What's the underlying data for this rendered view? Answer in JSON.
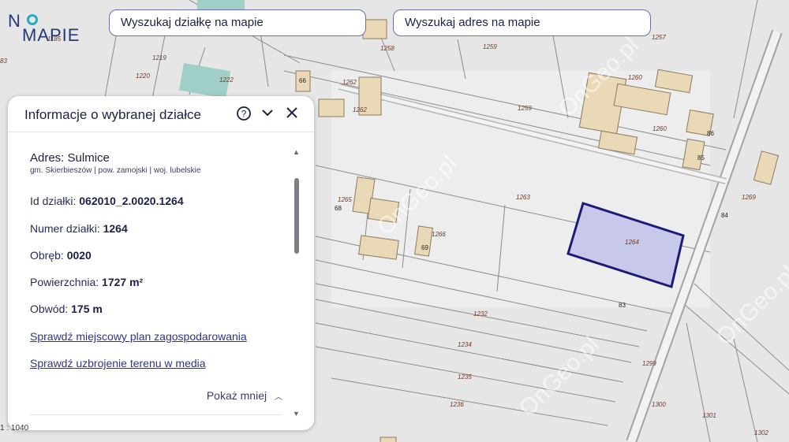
{
  "logo": {
    "line1": "N",
    "line2": "MAPIE"
  },
  "search": {
    "parcel_label": "Wyszukaj działkę na mapie",
    "address_label": "Wyszukaj adres na mapie"
  },
  "panel": {
    "title": "Informacje o wybranej działce",
    "help_icon": "help-circle-icon",
    "collapse_icon": "chevron-down-icon",
    "close_icon": "close-icon",
    "address_label": "Adres:",
    "address_value": "Sulmice",
    "admin_line": "gm. Skierbieszów | pow. zamojski | woj. lubelskie",
    "fields": [
      {
        "label": "Id działki:",
        "value": "062010_2.0020.1264"
      },
      {
        "label": "Numer działki:",
        "value": "1264"
      },
      {
        "label": "Obręb:",
        "value": "0020"
      },
      {
        "label": "Powierzchnia:",
        "value": "1727 m²"
      },
      {
        "label": "Obwód:",
        "value": "175 m"
      }
    ],
    "link_plan": "Sprawdź miejscowy plan zagospodarowania",
    "link_media": "Sprawdź uzbrojenie terenu w media",
    "show_less": "Pokaż mniej",
    "show_less_icon": "chevron-up-icon"
  },
  "scale_text": "1 : 1040",
  "watermark": "OnGeo.pl",
  "map_labels": [
    "1185",
    "83",
    "1219",
    "1220",
    "1222",
    "1258",
    "1259",
    "1257",
    "66",
    "1262",
    "1262",
    "1259",
    "1260",
    "1260",
    "86",
    "85",
    "1269",
    "84",
    "1265",
    "68",
    "1263",
    "1266",
    "69",
    "1264",
    "83",
    "1232",
    "1234",
    "1235",
    "1236",
    "1299",
    "1300",
    "1301",
    "1302"
  ],
  "colors": {
    "selected_fill": "#c8c9ea",
    "selected_stroke": "#1c1c78",
    "building": "#ead9b6",
    "water": "#9fcfc6"
  }
}
